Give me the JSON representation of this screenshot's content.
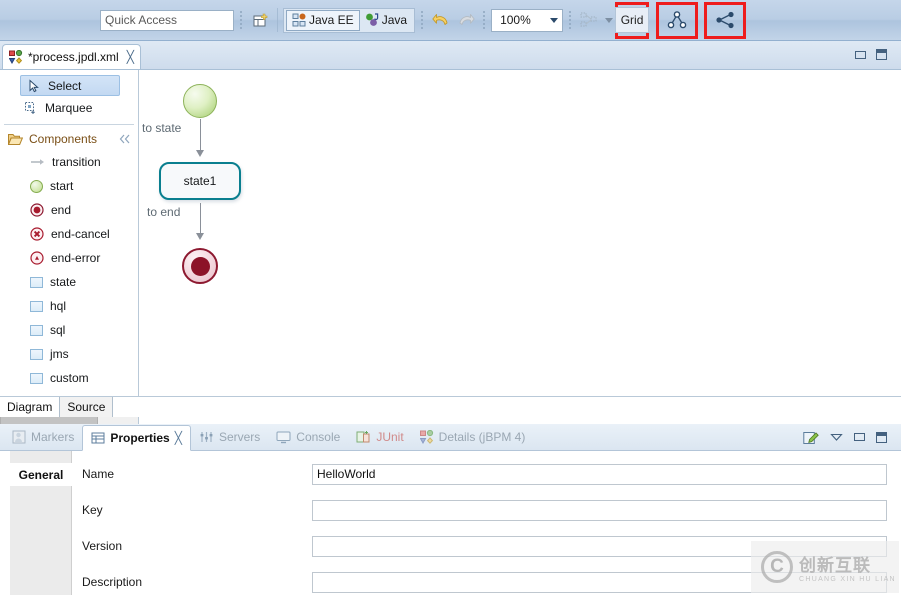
{
  "toolbar": {
    "quick_access": {
      "label": "Quick Access",
      "placeholder": "Quick Access"
    },
    "new_icon": "new-wizard-icon",
    "perspectives": [
      {
        "label": "Java EE",
        "icon": "java-ee-perspective-icon",
        "active": true
      },
      {
        "label": "Java",
        "icon": "java-perspective-icon",
        "active": false
      }
    ],
    "undo_icon": "undo-arrow-icon",
    "redo_icon": "redo-arrow-icon",
    "zoom": {
      "value": "100%",
      "caret": "chevron-down-icon"
    },
    "layout_icon": "auto-layout-icon",
    "layout_caret": "chevron-down-icon",
    "grid_button": {
      "label": "Grid",
      "highlighted": true
    },
    "graph_button": {
      "icon": "node-graph-icon",
      "highlighted": true
    },
    "share_button": {
      "icon": "share-nodes-icon",
      "highlighted": true
    },
    "highlight_color": "#ee1c1c"
  },
  "editor": {
    "tab": {
      "title": "*process.jpdl.xml",
      "icon": "jpdl-process-icon",
      "close": "╳"
    },
    "controls": {
      "minimize": "minimize-icon",
      "maximize": "maximize-icon"
    },
    "bottom_tabs": [
      {
        "label": "Diagram",
        "active": true
      },
      {
        "label": "Source",
        "active": false
      }
    ]
  },
  "palette": {
    "tools": [
      {
        "label": "Select",
        "icon": "cursor-arrow-icon",
        "selected": true
      },
      {
        "label": "Marquee",
        "icon": "marquee-select-icon",
        "selected": false
      }
    ],
    "group": {
      "label": "Components",
      "icon": "folder-open-icon",
      "collapse_icon": "double-chevron-icon"
    },
    "components": [
      {
        "label": "transition",
        "icon": "transition-arrow-icon"
      },
      {
        "label": "start",
        "icon": "start-node-icon"
      },
      {
        "label": "end",
        "icon": "end-node-icon"
      },
      {
        "label": "end-cancel",
        "icon": "end-cancel-node-icon"
      },
      {
        "label": "end-error",
        "icon": "end-error-node-icon"
      },
      {
        "label": "state",
        "icon": "state-node-icon"
      },
      {
        "label": "hql",
        "icon": "hql-node-icon"
      },
      {
        "label": "sql",
        "icon": "sql-node-icon"
      },
      {
        "label": "jms",
        "icon": "jms-node-icon"
      },
      {
        "label": "custom",
        "icon": "custom-node-icon"
      }
    ]
  },
  "diagram": {
    "nodes": [
      {
        "id": "start",
        "type": "start",
        "label": ""
      },
      {
        "id": "state1",
        "type": "state",
        "label": "state1"
      },
      {
        "id": "end",
        "type": "end",
        "label": ""
      }
    ],
    "edges": [
      {
        "from": "start",
        "to": "state1",
        "label": "to state"
      },
      {
        "from": "state1",
        "to": "end",
        "label": "to end"
      }
    ]
  },
  "properties_view": {
    "tabs": [
      {
        "label": "Markers",
        "icon": "markers-icon",
        "active": false
      },
      {
        "label": "Properties",
        "icon": "properties-icon",
        "active": true,
        "close": "╳"
      },
      {
        "label": "Servers",
        "icon": "servers-icon",
        "active": false
      },
      {
        "label": "Console",
        "icon": "console-icon",
        "active": false
      },
      {
        "label": "JUnit",
        "icon": "junit-icon",
        "active": false
      },
      {
        "label": "Details (jBPM 4)",
        "icon": "details-jbpm-icon",
        "active": false
      }
    ],
    "controls": {
      "pin": "pin-edit-icon",
      "menu": "view-menu-icon",
      "minimize": "minimize-icon",
      "maximize": "maximize-icon"
    },
    "side_tabs": [
      {
        "label": "General",
        "active": true
      }
    ],
    "fields": [
      {
        "label": "Name",
        "value": "HelloWorld"
      },
      {
        "label": "Key",
        "value": ""
      },
      {
        "label": "Version",
        "value": ""
      },
      {
        "label": "Description",
        "value": ""
      }
    ]
  },
  "watermark": {
    "logo": "C",
    "cn": "创新互联",
    "en": "CHUANG XIN HU LIAN"
  }
}
